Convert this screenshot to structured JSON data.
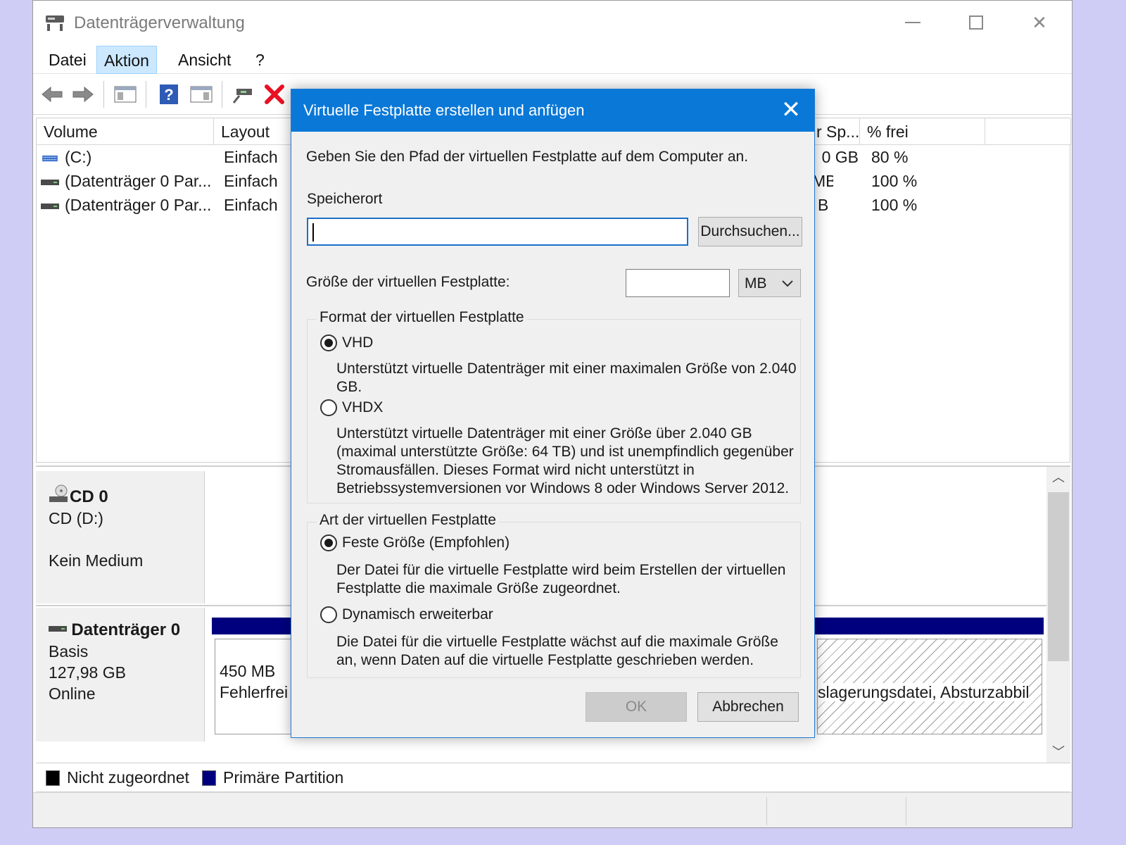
{
  "window": {
    "title": "Datenträgerverwaltung"
  },
  "menu": {
    "items": [
      "Datei",
      "Aktion",
      "Ansicht",
      "?"
    ],
    "active": "Aktion"
  },
  "volume_list": {
    "columns": [
      "Volume",
      "Layout",
      "r Sp...",
      "% frei"
    ],
    "rows": [
      {
        "volume": "(C:)",
        "layout": "Einfach",
        "free_space": "0 GB",
        "percent_free": "80 %"
      },
      {
        "volume": "(Datenträger 0 Par...",
        "layout": "Einfach",
        "free_space": "MB",
        "percent_free": "100 %"
      },
      {
        "volume": "(Datenträger 0 Par...",
        "layout": "Einfach",
        "free_space": "B",
        "percent_free": "100 %"
      }
    ]
  },
  "disks": {
    "cd": {
      "name": "CD 0",
      "drive": "CD (D:)",
      "status": "Kein Medium"
    },
    "disk0": {
      "name": "Datenträger 0",
      "type": "Basis",
      "size": "127,98 GB",
      "state": "Online",
      "partition1_size": "450 MB",
      "partition1_status": "Fehlerfrei",
      "partition3_text": "slagerungsdatei, Absturzabbil"
    }
  },
  "legend": {
    "unallocated": "Nicht zugeordnet",
    "primary": "Primäre Partition",
    "unallocated_color": "#000000",
    "primary_color": "#00007f"
  },
  "dialog": {
    "title": "Virtuelle Festplatte erstellen und anfügen",
    "intro": "Geben Sie den Pfad der virtuellen Festplatte auf dem Computer an.",
    "location_label": "Speicherort",
    "location_value": "",
    "browse_button": "Durchsuchen...",
    "size_label": "Größe der virtuellen Festplatte:",
    "size_value": "",
    "size_unit": "MB",
    "format_group": "Format der virtuellen Festplatte",
    "vhd_label": "VHD",
    "vhd_desc": "Unterstützt virtuelle Datenträger mit einer maximalen Größe von 2.040 GB.",
    "vhdx_label": "VHDX",
    "vhdx_desc": "Unterstützt virtuelle Datenträger mit einer Größe über 2.040 GB (maximal unterstützte Größe: 64 TB) und ist unempfindlich gegenüber Stromausfällen. Dieses Format wird nicht unterstützt in Betriebssystemversionen vor Windows 8 oder Windows Server 2012.",
    "format_selected": "VHD",
    "type_group": "Art der virtuellen Festplatte",
    "fixed_label": "Feste Größe (Empfohlen)",
    "fixed_desc": "Der Datei für die virtuelle Festplatte wird beim Erstellen der virtuellen Festplatte die maximale Größe zugeordnet.",
    "dynamic_label": "Dynamisch erweiterbar",
    "dynamic_desc": "Die Datei für die virtuelle Festplatte wächst auf die maximale Größe an, wenn Daten auf die virtuelle Festplatte geschrieben werden.",
    "type_selected": "Feste Größe (Empfohlen)",
    "ok_button": "OK",
    "cancel_button": "Abbrechen"
  },
  "colors": {
    "dialog_title_bg": "#0a78d7",
    "partition_bar": "#00007f",
    "delete_icon": "#e81123"
  }
}
